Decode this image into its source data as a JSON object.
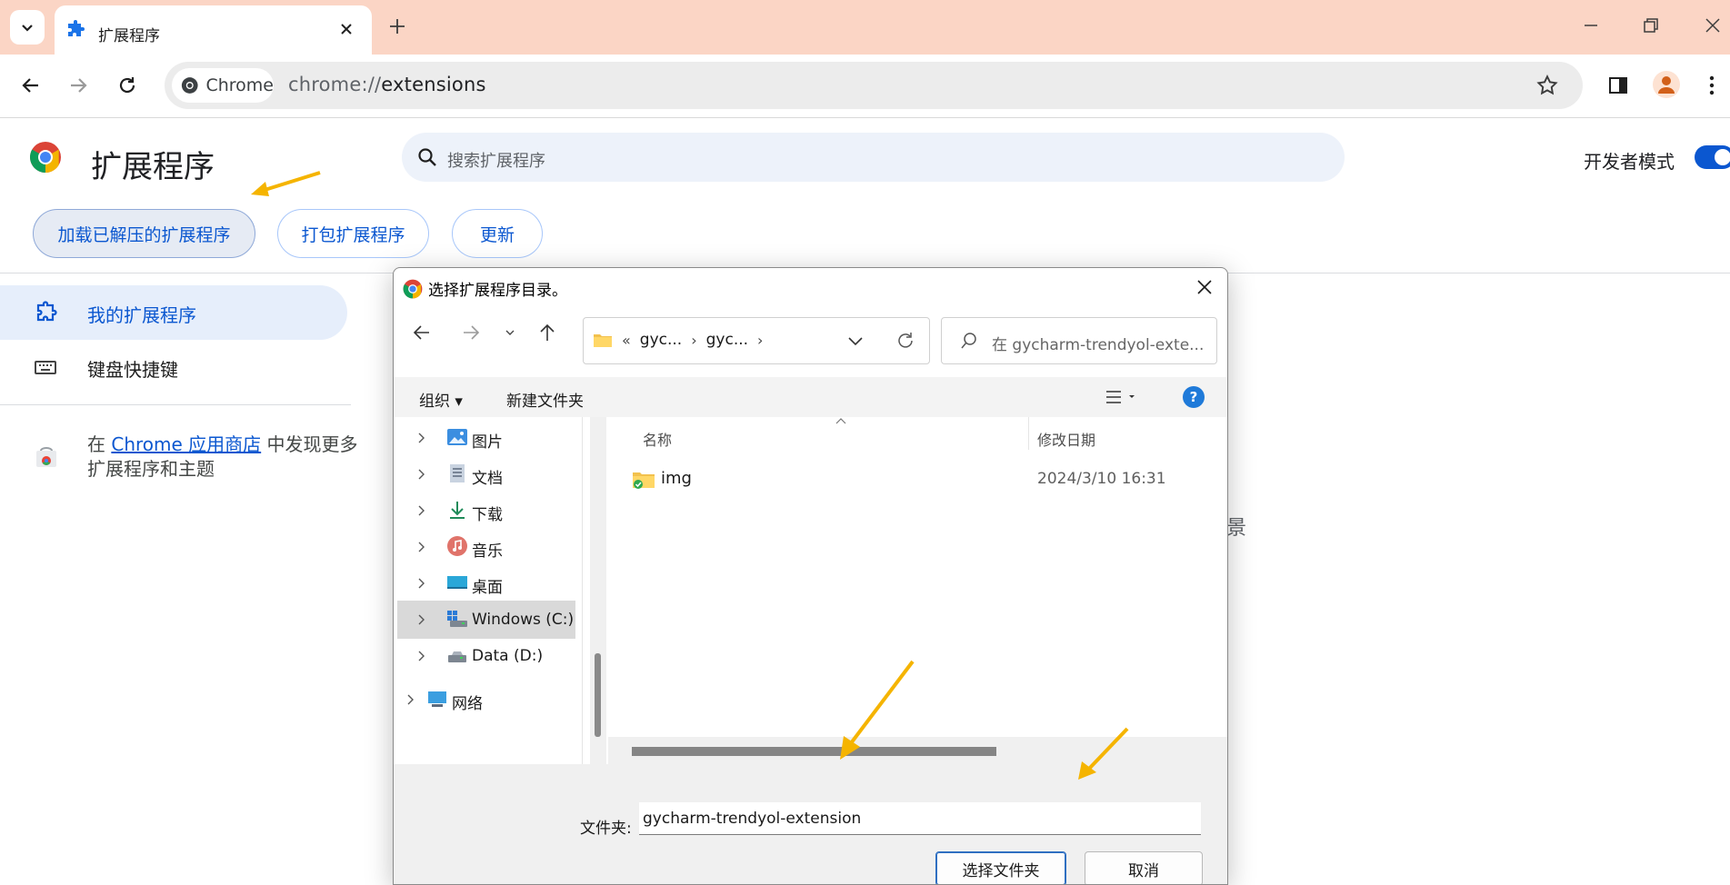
{
  "browser": {
    "tab": {
      "title": "扩展程序"
    },
    "omnibox": {
      "chip_label": "Chrome",
      "url_scheme": "chrome://",
      "url_host": "extensions"
    }
  },
  "page": {
    "title": "扩展程序",
    "search_placeholder": "搜索扩展程序",
    "dev_mode_label": "开发者模式",
    "dev_mode_on": true,
    "actions": {
      "load_unpacked": "加载已解压的扩展程序",
      "pack": "打包扩展程序",
      "update": "更新"
    },
    "sidebar": {
      "items": [
        {
          "label": "我的扩展程序"
        },
        {
          "label": "键盘快捷键"
        }
      ],
      "store_prefix": "在 ",
      "store_link": "Chrome 应用商店",
      "store_suffix": " 中发现更多扩展程序和主题"
    },
    "background_fragment": "景"
  },
  "dialog": {
    "title": "选择扩展程序目录。",
    "breadcrumb": {
      "overflow": "«",
      "seg1": "gyc...",
      "seg2": "gyc..."
    },
    "search_placeholder": "在 gycharm-trendyol-exte...",
    "commands": {
      "organize": "组织",
      "new_folder": "新建文件夹",
      "help": "?"
    },
    "tree": [
      {
        "label": "图片"
      },
      {
        "label": "文档"
      },
      {
        "label": "下载"
      },
      {
        "label": "音乐"
      },
      {
        "label": "桌面"
      },
      {
        "label": "Windows (C:)"
      },
      {
        "label": "Data (D:)"
      },
      {
        "label": "网络"
      }
    ],
    "columns": {
      "name": "名称",
      "modified": "修改日期"
    },
    "files": [
      {
        "name": "img",
        "modified": "2024/3/10 16:31"
      }
    ],
    "folder_label": "文件夹:",
    "folder_value": "gycharm-trendyol-extension",
    "select_button": "选择文件夹",
    "cancel_button": "取消"
  },
  "colors": {
    "tabstrip": "#fbd5c5",
    "accent": "#0b57d0",
    "annotation_arrow": "#f5b400"
  }
}
